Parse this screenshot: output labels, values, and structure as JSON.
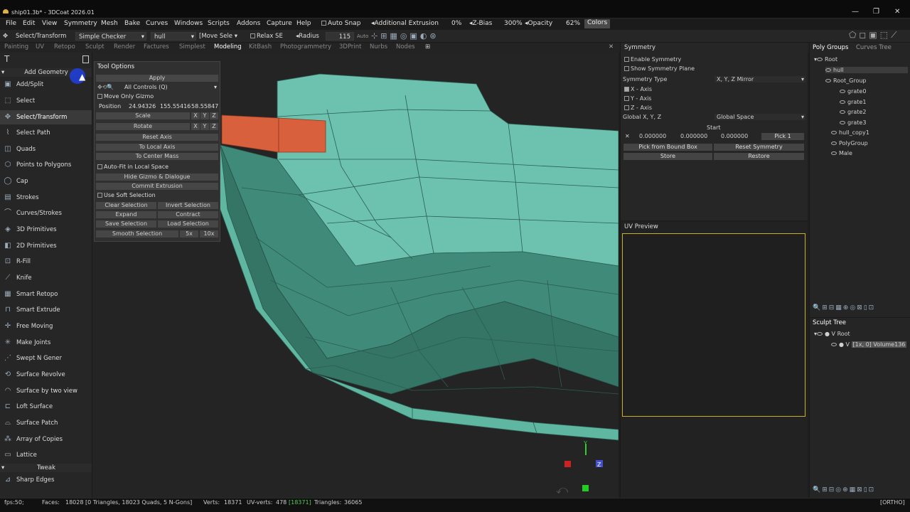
{
  "window": {
    "title": "ship01.3b* - 3DCoat 2026.01",
    "minimize": "—",
    "maximize": "❐",
    "close": "✕"
  },
  "menu": [
    "File",
    "Edit",
    "View",
    "Symmetry",
    "Mesh",
    "Bake",
    "Curves",
    "Windows",
    "Scripts",
    "Addons",
    "Capture",
    "Help"
  ],
  "toolbar": {
    "auto_snap": "Auto Snap",
    "additional_extrusion": "Additional Extrusion",
    "extrusion_value": "0%",
    "zbias": "Z-Bias",
    "zbias_value": "300%",
    "opacity": "Opacity",
    "opacity_value": "62%",
    "colors": "Colors",
    "mode": "Select/Transform",
    "checker": "Simple Checker",
    "object": "hull",
    "move_select": "Move Sele",
    "relax": "Relax SE",
    "radius": "Radius",
    "radius_value": "115",
    "auto": "Auto"
  },
  "rooms": [
    "Painting",
    "UV",
    "Retopo",
    "Sculpt",
    "Render",
    "Factures",
    "Simplest",
    "Modeling",
    "KitBash",
    "Photogrammetry",
    "3DPrint",
    "Nurbs",
    "Nodes"
  ],
  "active_room": "Modeling",
  "left_panel": {
    "section_add": "Add Geometry",
    "section_tweak": "Tweak",
    "tools": [
      "Add/Split",
      "Select",
      "Select/Transform",
      "Select Path",
      "Quads",
      "Points to Polygons",
      "Cap",
      "Strokes",
      "Curves/Strokes",
      "3D Primitives",
      "2D Primitives",
      "R-Fill",
      "Knife",
      "Smart Retopo",
      "Smart Extrude",
      "Free Moving",
      "Make Joints",
      "Swept N Gener",
      "Surface Revolve",
      "Surface by two view",
      "Loft Surface",
      "Surface Patch",
      "Array of Copies",
      "Lattice"
    ],
    "tweak_tools": [
      "Sharp Edges"
    ],
    "selected": "Select/Transform"
  },
  "tool_options": {
    "title": "Tool Options",
    "apply": "Apply",
    "controls": "All Controls (Q)",
    "move_only_gizmo": "Move Only Gizmo",
    "position_label": "Position",
    "position": [
      "24.94326",
      "155.55416",
      "58.55847"
    ],
    "scale": "Scale",
    "rotate": "Rotate",
    "x": "X",
    "y": "Y",
    "z": "Z",
    "reset_axis": "Reset Axis",
    "to_local_axis": "To Local Axis",
    "to_center_mass": "To Center Mass",
    "auto_fit": "Auto-Fit in Local Space",
    "hide_gizmo": "Hide Gizmo & Dialogue",
    "commit_extrusion": "Commit Extrusion",
    "use_soft_selection": "Use Soft Selection",
    "clear_selection": "Clear Selection",
    "invert_selection": "Invert Selection",
    "expand": "Expand",
    "contract": "Contract",
    "save_selection": "Save Selection",
    "load_selection": "Load Selection",
    "smooth_selection": "Smooth Selection",
    "x5": "5x",
    "x10": "10x"
  },
  "symmetry": {
    "title": "Symmetry",
    "enable": "Enable Symmetry",
    "show_plane": "Show Symmetry Plane",
    "type_label": "Symmetry Type",
    "type_value": "X, Y, Z Mirror",
    "x_axis": "X - Axis",
    "y_axis": "Y - Axis",
    "z_axis": "Z - Axis",
    "global_label": "Global X, Y, Z",
    "global_value": "Global Space",
    "start": "Start",
    "coords": [
      "0.000000",
      "0.000000",
      "0.000000"
    ],
    "pick": "Pick 1",
    "pick_bound": "Pick from Bound Box",
    "reset": "Reset Symmetry",
    "store": "Store",
    "restore": "Restore"
  },
  "uv_preview": {
    "title": "UV Preview"
  },
  "poly_groups": {
    "tab1": "Poly Groups",
    "tab2": "Curves Tree",
    "items": [
      "Root",
      "hull",
      "Root_Group",
      "grate0",
      "grate1",
      "grate2",
      "grate3",
      "hull_copy1",
      "PolyGroup",
      "Male"
    ]
  },
  "sculpt_tree": {
    "title": "Sculpt Tree",
    "root": "Root",
    "volume_tag": "[1x, 0]",
    "volume": "Volume136"
  },
  "status": {
    "fps": "fps:50;",
    "faces_label": "Faces:",
    "faces": "18028 [0 Triangles, 18023 Quads, 5 N-Gons]",
    "verts_label": "Verts:",
    "verts": "18371",
    "uvverts_label": "UV-verts:",
    "uvverts": "478",
    "uvverts_hl": "[18371]",
    "tris_label": "Triangles:",
    "tris": "36065",
    "ortho": "[ORTHO]"
  },
  "colors": {
    "mesh": "#6cc2ae",
    "selected_face": "#d9603c",
    "accent_frame": "#c8b020"
  }
}
